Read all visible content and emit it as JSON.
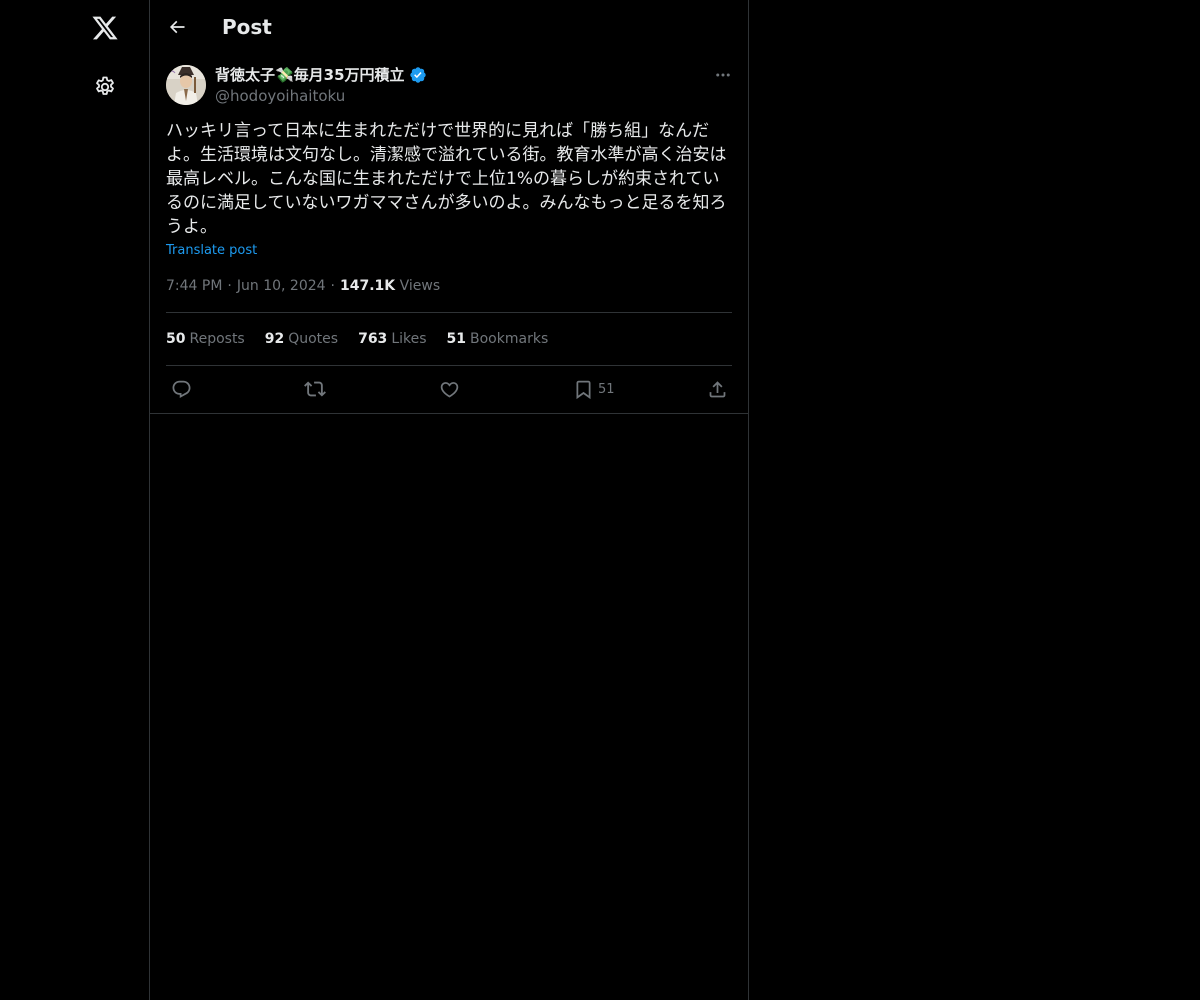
{
  "header": {
    "title": "Post"
  },
  "post": {
    "author": {
      "display_name": "背徳太子💸毎月35万円積立",
      "handle": "@hodoyoihaitoku"
    },
    "text": "ハッキリ言って日本に生まれただけで世界的に見れば「勝ち組」なんだよ。生活環境は文句なし。清潔感で溢れている街。教育水準が高く治安は最高レベル。こんな国に生まれただけで上位1%の暮らしが約束されているのに満足していないワガママさんが多いのよ。みんなもっと足るを知ろうよ。",
    "translate_label": "Translate post",
    "time": "7:44 PM",
    "date": "Jun 10, 2024",
    "views_count": "147.1K",
    "views_label": "Views",
    "stats": [
      {
        "count": "50",
        "label": "Reposts"
      },
      {
        "count": "92",
        "label": "Quotes"
      },
      {
        "count": "763",
        "label": "Likes"
      },
      {
        "count": "51",
        "label": "Bookmarks"
      }
    ],
    "actions": {
      "bookmark_count": "51"
    }
  },
  "colors": {
    "background": "#000000",
    "text_primary": "#e7e9ea",
    "text_secondary": "#71767b",
    "accent": "#1d9bf0",
    "border": "#2f3336"
  },
  "icons": {
    "logo": "x-logo-icon",
    "settings": "gear-icon",
    "back": "arrow-left-icon",
    "verified": "verified-badge-icon",
    "more": "more-horizontal-icon",
    "reply": "reply-icon",
    "repost": "repost-icon",
    "like": "heart-icon",
    "bookmark": "bookmark-icon",
    "share": "share-icon"
  }
}
